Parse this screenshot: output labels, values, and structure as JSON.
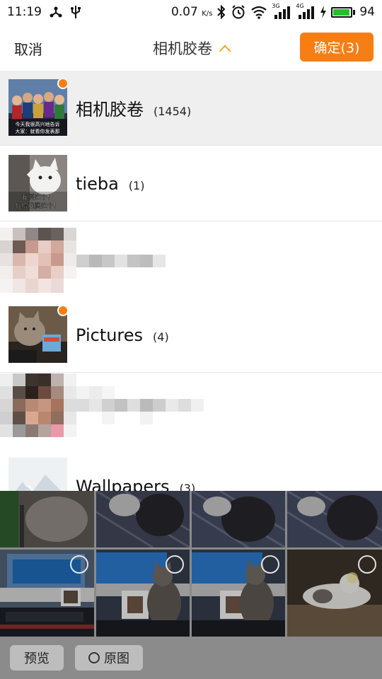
{
  "status_bar": {
    "time": "11:19",
    "net_speed": "0.07",
    "net_speed_unit": "K/s",
    "signal1_label": "3G",
    "signal2_label": "4G",
    "battery": "94",
    "battery_level": 0.94,
    "battery_color": "#22c02a",
    "icons": [
      "usb-share-icon",
      "usb-icon",
      "bluetooth-icon",
      "alarm-icon",
      "wifi-icon",
      "signal-icon",
      "charging-icon"
    ]
  },
  "header": {
    "cancel_label": "取消",
    "title": "相机胶卷",
    "confirm_label": "确定(3)",
    "accent_color": "#f77e15"
  },
  "albums": [
    {
      "name": "相机胶卷",
      "count": "(1454)",
      "selected": true,
      "has_selection": true
    },
    {
      "name": "tieba",
      "count": "(1)",
      "selected": false,
      "has_selection": false
    },
    {
      "name": "",
      "count": "",
      "selected": false,
      "has_selection": false,
      "obscured": true
    },
    {
      "name": "Pictures",
      "count": "(4)",
      "selected": false,
      "has_selection": true
    },
    {
      "name": "",
      "count": "",
      "selected": false,
      "has_selection": false,
      "obscured": true
    },
    {
      "name": "Wallpapers",
      "count": "(3)",
      "selected": false,
      "has_selection": false
    }
  ],
  "thumb_captions": {
    "album0": "今天我很高兴地告诉\n大家：就看你发表那",
    "album1": "我要这个！\n你给我买这个！"
  },
  "bottom_bar": {
    "preview_label": "预览",
    "original_label": "原图"
  }
}
